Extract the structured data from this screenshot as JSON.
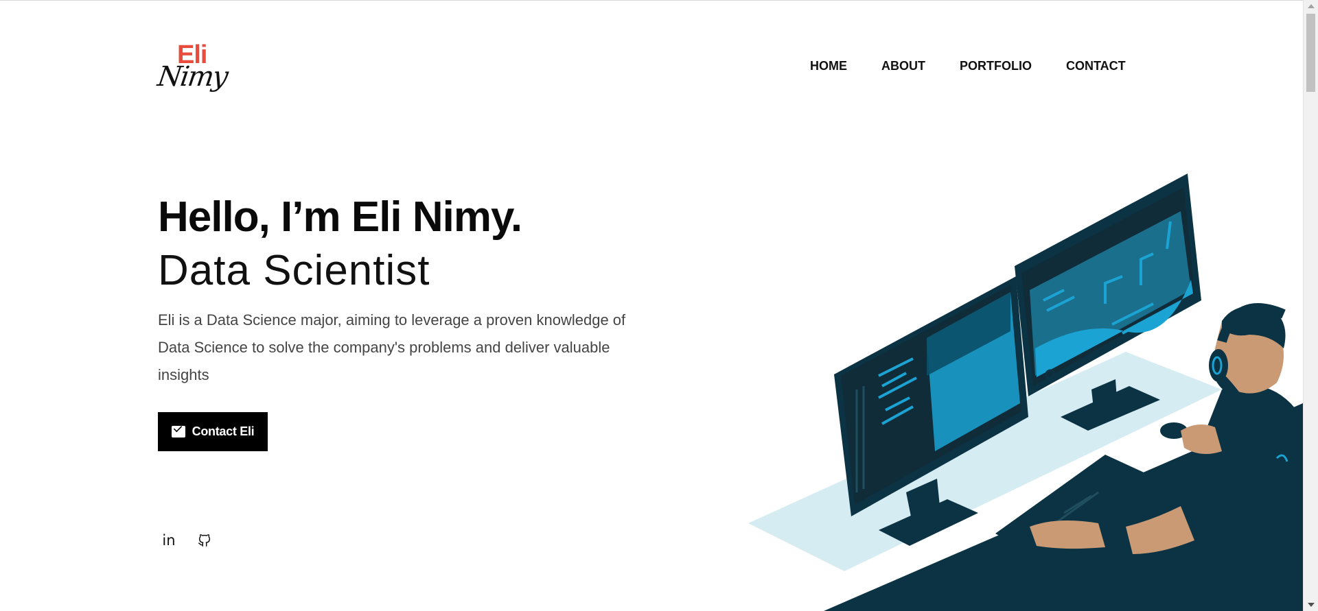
{
  "brand": {
    "logo_top": "Eli",
    "logo_bottom": "Nimy",
    "accent_color": "#e94b3c"
  },
  "nav": {
    "items": [
      {
        "label": "HOME"
      },
      {
        "label": "ABOUT"
      },
      {
        "label": "PORTFOLIO"
      },
      {
        "label": "CONTACT"
      }
    ]
  },
  "hero": {
    "title": "Hello, I’m Eli Nimy.",
    "subtitle": "Data Scientist",
    "description": "Eli is a Data Science major, aiming to leverage a proven knowledge of Data Science to solve the company's problems and deliver valuable insights",
    "cta_label": "Contact Eli",
    "cta_icon": "mail-icon"
  },
  "socials": [
    {
      "icon": "linkedin-icon",
      "text": "in"
    },
    {
      "icon": "github-icon"
    }
  ],
  "illustration": {
    "icon": "person-at-computer-illustration",
    "colors": {
      "dark": "#0b3344",
      "accent": "#1aa3d3",
      "shadow": "#d4ecf2",
      "skin": "#c99a74"
    }
  }
}
